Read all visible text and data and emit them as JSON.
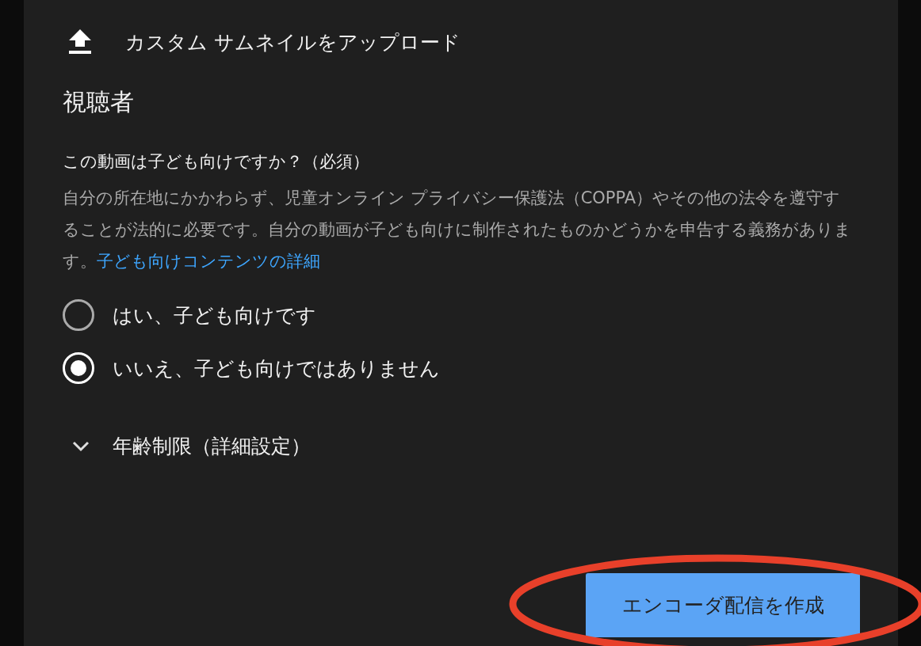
{
  "upload_thumbnail": {
    "label": "カスタム サムネイルをアップロード"
  },
  "audience": {
    "heading": "視聴者",
    "question": "この動画は子ども向けですか？（必須）",
    "description": "自分の所在地にかかわらず、児童オンライン プライバシー保護法（COPPA）やその他の法令を遵守することが法的に必要です。自分の動画が子ども向けに制作されたものかどうかを申告する義務があります。",
    "link": "子ども向けコンテンツの詳細",
    "options": [
      {
        "label": "はい、子ども向けです",
        "selected": false
      },
      {
        "label": "いいえ、子ども向けではありません",
        "selected": true
      }
    ]
  },
  "age_restriction": {
    "label": "年齢制限（詳細設定）",
    "expanded": false
  },
  "create_button": {
    "label": "エンコーダ配信を作成"
  },
  "annotation": {
    "kind": "ellipse",
    "color": "#e8402a"
  }
}
